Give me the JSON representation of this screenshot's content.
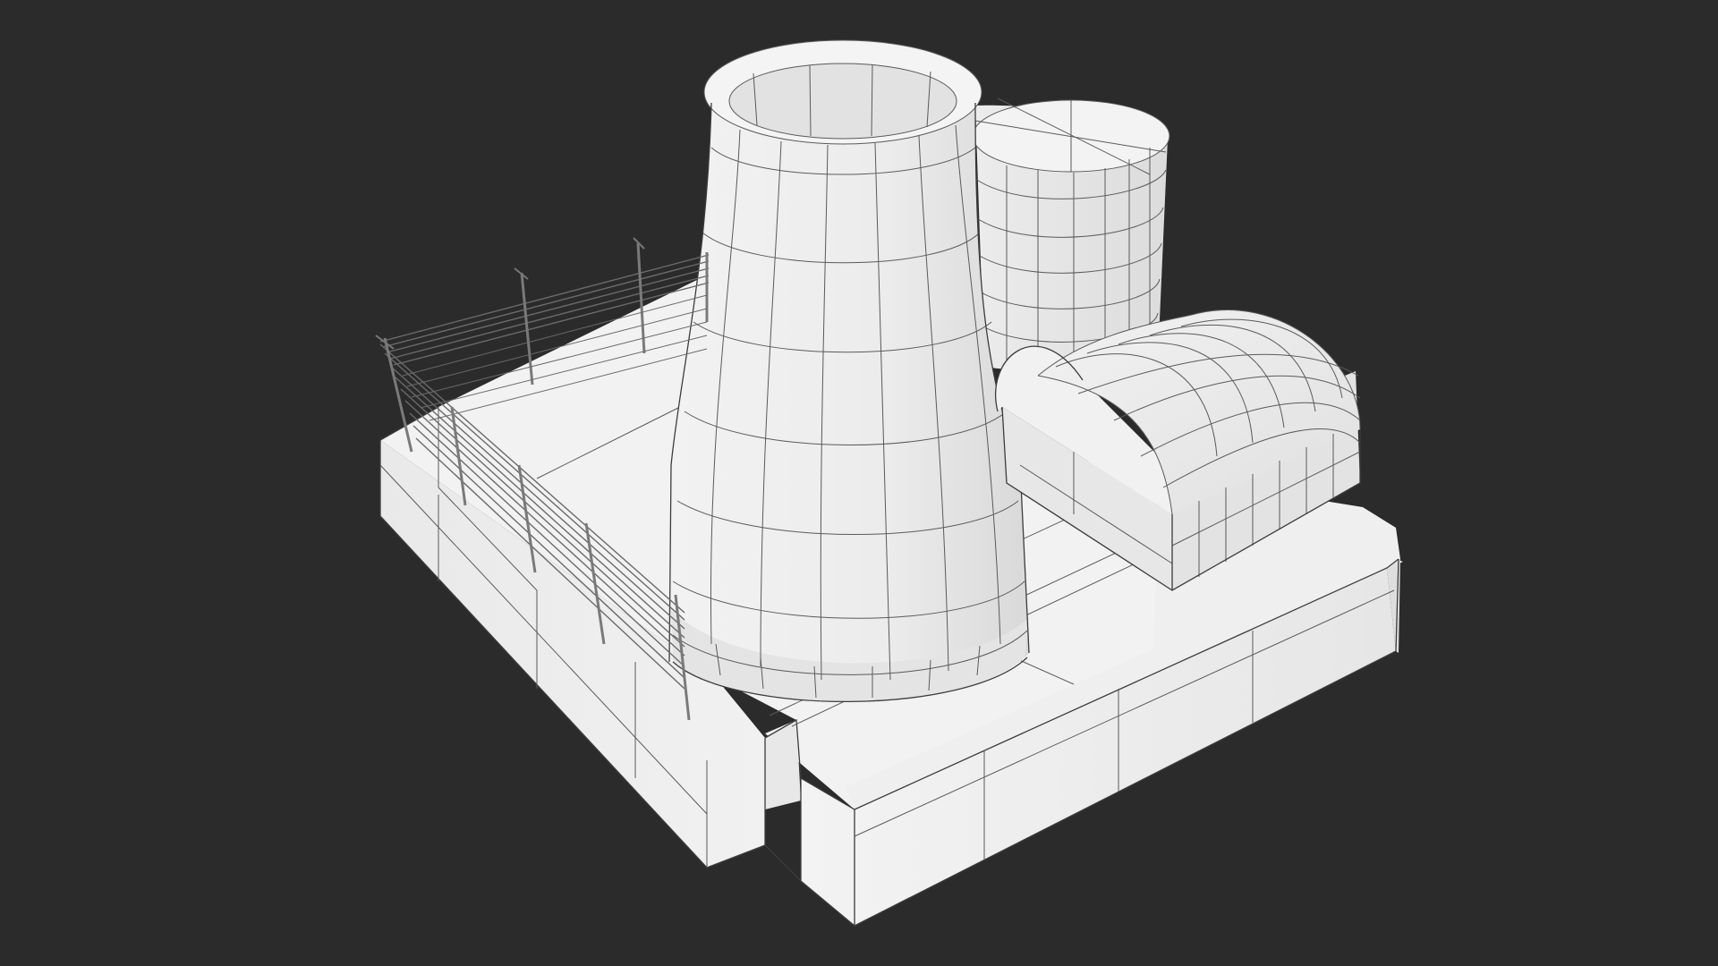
{
  "viewport": {
    "background": "#2b2b2b",
    "render_mode": "clay-wireframe-overlay"
  },
  "model": {
    "subject": "power plant",
    "surface_color": "#efefef",
    "wire_color": "#5a5a5a",
    "parts": [
      "base-platform",
      "cooling-tower",
      "cylindrical-storage-tank",
      "quonset-hangar",
      "perimeter-fence"
    ]
  }
}
